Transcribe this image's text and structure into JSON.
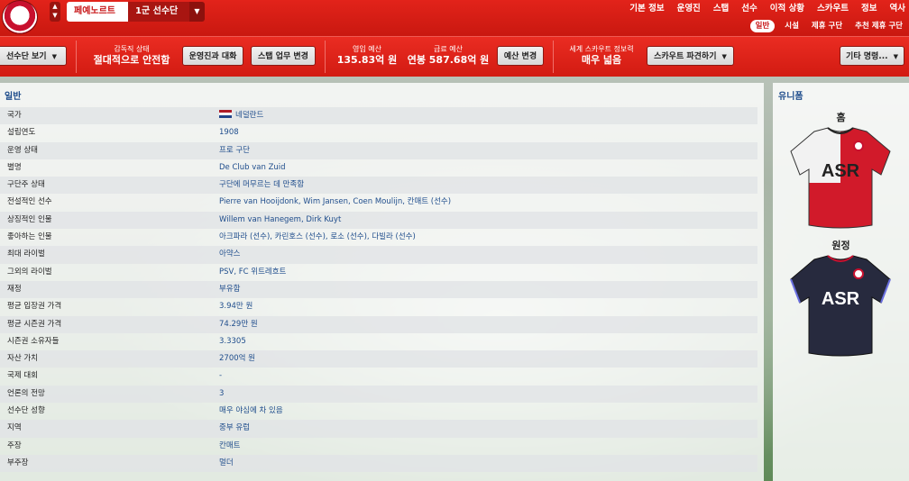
{
  "header": {
    "tab_club": "페예노르트",
    "tab_squad": "1군 선수단",
    "nav": [
      "기본 정보",
      "운영진",
      "스탭",
      "선수",
      "이적 상황",
      "스카우트",
      "정보",
      "역사"
    ],
    "subnav": [
      "일반",
      "시설",
      "제휴 구단",
      "추천 제휴 구단"
    ]
  },
  "toolbar": {
    "squad_view_label": "선수단 보기",
    "board_status_key": "감독직 상태",
    "board_status_value": "절대적으로 안전함",
    "talk_board_label": "운영진과 대화",
    "staff_duties_label": "스탭 업무 변경",
    "budget_key": "영입 예산",
    "budget_value": "135.83억 원",
    "wage_key": "급료 예산",
    "wage_value": "연봉 587.68억 원",
    "budget_change_label": "예산 변경",
    "scout_key": "세계 스카우트 정보력",
    "scout_value": "매우 넓음",
    "scout_dispatch_label": "스카우트 파견하기",
    "other_orders_label": "기타 명령..."
  },
  "general": {
    "title": "일반",
    "rows": [
      {
        "label": "국가",
        "value": "네덜란드",
        "flag": true
      },
      {
        "label": "설립연도",
        "value": "1908"
      },
      {
        "label": "운영 상태",
        "value": "프로 구단"
      },
      {
        "label": "별명",
        "value": "De Club van Zuid"
      },
      {
        "label": "구단주 상태",
        "value": "구단에 머무르는 데 만족함"
      },
      {
        "label": "전설적인 선수",
        "value": "Pierre van Hooijdonk, Wim Jansen, Coen Moulijn, 칸매트 (선수)"
      },
      {
        "label": "상징적인 인물",
        "value": "Willem van Hanegem, Dirk Kuyt"
      },
      {
        "label": "좋아하는 인물",
        "value": "아크파라 (선수), 카린호스 (선수), 로소 (선수), 다빌라 (선수)"
      },
      {
        "label": "최대 라이벌",
        "value": "아약스"
      },
      {
        "label": "그외의 라이벌",
        "value": "PSV, FC 위트레흐트"
      },
      {
        "label": "재정",
        "value": "부유함"
      },
      {
        "label": "평균 입장권 가격",
        "value": "3.94만 원"
      },
      {
        "label": "평균 시즌권 가격",
        "value": "74.29만 원"
      },
      {
        "label": "시즌권 소유자들",
        "value": "3.3305"
      },
      {
        "label": "자산 가치",
        "value": "2700억 원"
      },
      {
        "label": "국제 대회",
        "value": "-"
      },
      {
        "label": "언론의 전망",
        "value": "3"
      },
      {
        "label": "선수단 성향",
        "value": "매우 야심에 차 있음"
      },
      {
        "label": "지역",
        "value": "중부 유럽"
      },
      {
        "label": "주장",
        "value": "칸매트"
      },
      {
        "label": "부주장",
        "value": "멀더"
      }
    ]
  },
  "kits": {
    "title": "유니폼",
    "home_label": "홈",
    "away_label": "원정",
    "sponsor": "ASR"
  }
}
